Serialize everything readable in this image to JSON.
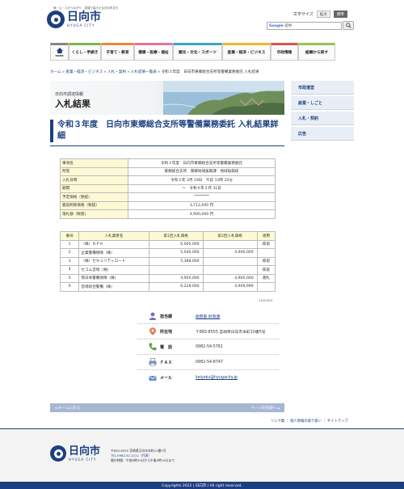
{
  "header": {
    "tagline": "海・山・人がつながり　笑顔で暮らせる日向市まち",
    "logo_kanji": "日向市",
    "logo_roman": "HYUGA CITY",
    "textsize_label": "文字サイズ",
    "textsize_large": "拡大",
    "textsize_standard": "標準",
    "search_brand": "Google",
    "search_suffix": "提供"
  },
  "nav": {
    "home": "HOME",
    "items": [
      {
        "label": "くらし・手続き",
        "color": "#7bb84b"
      },
      {
        "label": "子育て・教育",
        "color": "#e48a3c"
      },
      {
        "label": "健康・医療・福祉",
        "color": "#e4769e"
      },
      {
        "label": "観光・文化・スポーツ",
        "color": "#3aa6c9"
      },
      {
        "label": "産業・経済・ビジネス",
        "color": "#e8b92e"
      },
      {
        "label": "市政情報",
        "color": "#d9534f"
      },
      {
        "label": "組織から探す",
        "color": "#9ac24d"
      }
    ]
  },
  "breadcrumb": {
    "home": "ホーム",
    "c1": "産業・経済・ビジネス",
    "c2": "入札・契約",
    "c3": "入札結果一覧表",
    "current": "令和３年度　日向市東郷総合支所等警備業務委託 入札結果"
  },
  "banner": {
    "sub": "日向市調達情報",
    "title": "入札結果"
  },
  "side": [
    "市政運営",
    "産業・しごと",
    "入札・契約",
    "広告"
  ],
  "page_title": "令和３年度　日向市東郷総合支所等警備業務委託 入札結果詳細",
  "summary": [
    {
      "label": "事項名",
      "value": "令和３年度　日向市東郷総合支所等警備業務委託"
    },
    {
      "label": "所管",
      "value": "東郷総合支所　東郷地域振興課　地域振興係"
    },
    {
      "label": "入札日時",
      "value": "令和３年 3月 19日　午前 11時 10分"
    },
    {
      "label": "期間",
      "value": "～　令和４年３月 31日"
    },
    {
      "label": "予定価格（税抜）",
      "value": "********"
    },
    {
      "label": "最低制限価格（税抜）",
      "value": "3,712,000 円"
    },
    {
      "label": "落札額（税抜）",
      "value": "4,900,000 円"
    }
  ],
  "bids": {
    "headers": [
      "番号",
      "入札業者名",
      "第1回入札価格",
      "第2回入札価格",
      "適用"
    ],
    "rows": [
      [
        "1",
        "（株）ＮＰＫ",
        "6,000,000",
        "",
        "辞退"
      ],
      [
        "2",
        "企業警備保障（株）",
        "5,040,000",
        "4,940,000",
        ""
      ],
      [
        "3",
        "（株）セキュリティロード",
        "5,388,000",
        "",
        "辞退"
      ],
      [
        "4",
        "セコム宮崎（株）",
        "",
        "",
        "辞退"
      ],
      [
        "5",
        "南日本警備保障（株）",
        "4,950,000",
        "4,900,000",
        "落札"
      ],
      [
        "6",
        "宮崎綜合警備（株）",
        "6,228,000",
        "4,949,999",
        ""
      ]
    ]
  },
  "doc_number": "21021901",
  "contact": {
    "dept_label": "担当課",
    "dept_value": "総務部 財政課",
    "addr_label": "所在地",
    "addr_value": "〒883-8555 宮崎県日向市本町10番5号",
    "tel_label": "電　話",
    "tel_value": "0982-54-5761",
    "fax_label": "ＦＡＸ",
    "fax_value": "0982-54-8747",
    "mail_label": "メール",
    "mail_value": "keiyaku@hyugacity.jp"
  },
  "footer_nav": {
    "home": "ホームに戻る",
    "top": "ページの先頭へ"
  },
  "footer_links": "リンク集 ｜ 個人情報の取り扱い ｜ サイトマップ",
  "footer": {
    "logo_kanji": "日向市",
    "logo_roman": "HYUGA CITY",
    "addr": "〒883-8555 宮崎県日向市本町10番5号",
    "tel": "TEL:0982-52-2111（代表）",
    "hours": "開庁時間：午前8時30分から午後5時15分まで",
    "copyright": "Copyrights 2022 | 日向市 / All right reserved."
  }
}
